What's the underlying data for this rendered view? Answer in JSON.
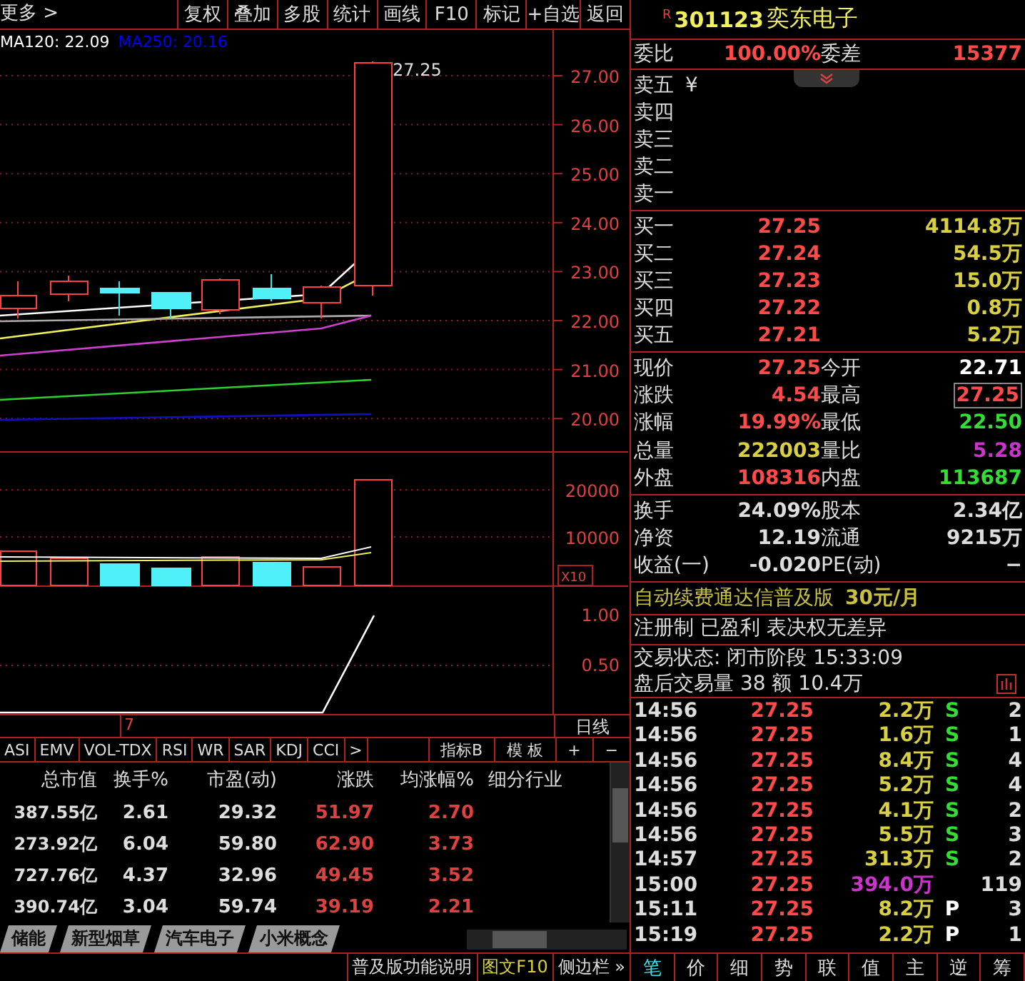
{
  "toolbar": {
    "more": "更多 >",
    "buttons": [
      "复权",
      "叠加",
      "多股",
      "统计",
      "画线",
      "F10",
      "标记",
      "+自选",
      "返回"
    ]
  },
  "chart": {
    "ma_legend": [
      {
        "text": "MA120: 22.09",
        "color": "#ffffff"
      },
      {
        "text": "MA250: 20.16",
        "color": "#0000ff"
      }
    ],
    "high_label": "27.25",
    "price_axis": [
      "27.00",
      "26.00",
      "25.00",
      "24.00",
      "23.00",
      "22.00",
      "21.00",
      "20.00"
    ],
    "volume_axis": [
      "20000",
      "10000"
    ],
    "volume_scale": "X10",
    "indicator_axis": [
      "1.00",
      "0.50"
    ],
    "x_label": "7",
    "period": "日线"
  },
  "indicator_tabs": [
    "ASI",
    "EMV",
    "VOL-TDX",
    "RSI",
    "WR",
    "SAR",
    "KDJ",
    "CCI",
    ">"
  ],
  "indicator_tools": [
    "指标B",
    "模 板",
    "+",
    "−"
  ],
  "table": {
    "columns": [
      "总市值",
      "换手%",
      "市盈(动)",
      "涨跌",
      "均涨幅%",
      "细分行业"
    ],
    "rows": [
      [
        "387.55亿",
        "2.61",
        "29.32",
        "51.97",
        "2.70"
      ],
      [
        "273.92亿",
        "6.04",
        "59.80",
        "62.90",
        "3.73"
      ],
      [
        "727.76亿",
        "4.37",
        "32.96",
        "49.45",
        "3.52"
      ],
      [
        "390.74亿",
        "3.04",
        "59.74",
        "39.19",
        "2.21"
      ]
    ]
  },
  "sector_tabs": [
    "储能",
    "新型烟草",
    "汽车电子",
    "小米概念"
  ],
  "status_bar": [
    {
      "text": "普及版功能说明",
      "kind": "plain"
    },
    {
      "text": "图文F10",
      "kind": "accent"
    },
    {
      "text": "侧边栏 »",
      "kind": "plain"
    }
  ],
  "stock": {
    "badge": "R",
    "code": "301123",
    "name": "奕东电子"
  },
  "ratio": [
    {
      "label": "委比",
      "value": "100.00%"
    },
    {
      "label": "委差",
      "value": "15377"
    }
  ],
  "currency": "¥",
  "sell": [
    "卖五",
    "卖四",
    "卖三",
    "卖二",
    "卖一"
  ],
  "buy": [
    {
      "label": "买一",
      "price": "27.25",
      "volume": "4114.8万"
    },
    {
      "label": "买二",
      "price": "27.24",
      "volume": "54.5万"
    },
    {
      "label": "买三",
      "price": "27.23",
      "volume": "15.0万"
    },
    {
      "label": "买四",
      "price": "27.22",
      "volume": "0.8万"
    },
    {
      "label": "买五",
      "price": "27.21",
      "volume": "5.2万"
    }
  ],
  "quote": [
    {
      "label": "现价",
      "value": "27.25",
      "color": "#ff4a4a",
      "highlighted": false
    },
    {
      "label": "今开",
      "value": "22.71",
      "color": "#ffffff",
      "highlighted": false
    },
    {
      "label": "涨跌",
      "value": "4.54",
      "color": "#ff4a4a",
      "highlighted": false
    },
    {
      "label": "最高",
      "value": "27.25",
      "color": "#ff4a4a",
      "highlighted": true
    },
    {
      "label": "涨幅",
      "value": "19.99%",
      "color": "#ff4a4a",
      "highlighted": false
    },
    {
      "label": "最低",
      "value": "22.50",
      "color": "#33dd33",
      "highlighted": false
    },
    {
      "label": "总量",
      "value": "222003",
      "color": "#d8d040",
      "highlighted": false
    },
    {
      "label": "量比",
      "value": "5.28",
      "color": "#cc33cc",
      "highlighted": false
    },
    {
      "label": "外盘",
      "value": "108316",
      "color": "#ff4a4a",
      "highlighted": false
    },
    {
      "label": "内盘",
      "value": "113687",
      "color": "#33dd33",
      "highlighted": false
    }
  ],
  "fundamentals": [
    {
      "label": "换手",
      "value": "24.09%"
    },
    {
      "label": "股本",
      "value": "2.34亿"
    },
    {
      "label": "净资",
      "value": "12.19"
    },
    {
      "label": "流通",
      "value": "9215万"
    },
    {
      "label": "收益(一)",
      "value": "-0.020"
    },
    {
      "label": "PE(动)",
      "value": "−"
    }
  ],
  "promo": {
    "text": "自动续费通达信普及版",
    "price": "30元/月"
  },
  "notes": [
    "注册制 已盈利 表决权无差异",
    "交易状态: 闭市阶段 15:33:09",
    "盘后交易量 38 额 10.4万"
  ],
  "trades": [
    {
      "time": "14:56",
      "price": "27.25",
      "volume": "2.2万",
      "large": false,
      "side": "S",
      "color": "#33dd33",
      "count": "2"
    },
    {
      "time": "14:56",
      "price": "27.25",
      "volume": "1.6万",
      "large": false,
      "side": "S",
      "color": "#33dd33",
      "count": "1"
    },
    {
      "time": "14:56",
      "price": "27.25",
      "volume": "8.4万",
      "large": false,
      "side": "S",
      "color": "#33dd33",
      "count": "4"
    },
    {
      "time": "14:56",
      "price": "27.25",
      "volume": "5.2万",
      "large": false,
      "side": "S",
      "color": "#33dd33",
      "count": "4"
    },
    {
      "time": "14:56",
      "price": "27.25",
      "volume": "4.1万",
      "large": false,
      "side": "S",
      "color": "#33dd33",
      "count": "2"
    },
    {
      "time": "14:56",
      "price": "27.25",
      "volume": "5.5万",
      "large": false,
      "side": "S",
      "color": "#33dd33",
      "count": "3"
    },
    {
      "time": "14:57",
      "price": "27.25",
      "volume": "31.3万",
      "large": false,
      "side": "S",
      "color": "#33dd33",
      "count": "2"
    },
    {
      "time": "15:00",
      "price": "27.25",
      "volume": "394.0万",
      "large": true,
      "count": "119"
    },
    {
      "time": "15:11",
      "price": "27.25",
      "volume": "8.2万",
      "large": false,
      "side": "P",
      "color": "#ffffff",
      "count": "3"
    },
    {
      "time": "15:19",
      "price": "27.25",
      "volume": "2.2万",
      "large": false,
      "side": "P",
      "color": "#ffffff",
      "count": "1"
    }
  ],
  "bottom_tabs": [
    {
      "label": "笔",
      "selected": true
    },
    {
      "label": "价",
      "selected": false
    },
    {
      "label": "细",
      "selected": false
    },
    {
      "label": "势",
      "selected": false
    },
    {
      "label": "联",
      "selected": false
    },
    {
      "label": "值",
      "selected": false
    },
    {
      "label": "主",
      "selected": false
    },
    {
      "label": "逆",
      "selected": false
    },
    {
      "label": "筹",
      "selected": false
    }
  ]
}
